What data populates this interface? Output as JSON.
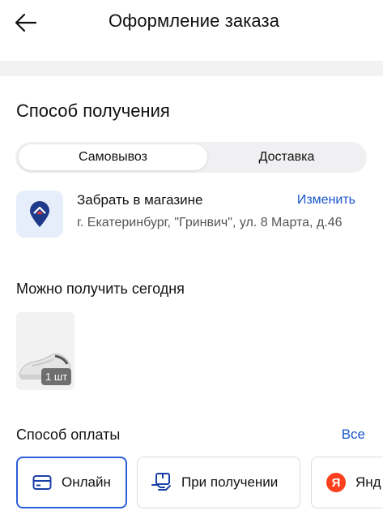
{
  "header": {
    "title": "Оформление заказа",
    "back_icon": "arrow-left-icon"
  },
  "receive": {
    "title": "Способ получения",
    "tabs": [
      {
        "label": "Самовывоз",
        "active": true
      },
      {
        "label": "Доставка",
        "active": false
      }
    ],
    "store": {
      "title": "Забрать в магазине",
      "change_label": "Изменить",
      "address": "г. Екатеринбург, \"Гринвич\", ул. 8 Марта, д.46",
      "icon": "map-pin-icon"
    }
  },
  "available": {
    "title": "Можно получить сегодня",
    "items": [
      {
        "qty": "1 шт",
        "image": "sneaker-image"
      }
    ]
  },
  "payment": {
    "title": "Способ оплаты",
    "all_label": "Все",
    "methods": [
      {
        "label": "Онлайн",
        "icon": "credit-card-icon",
        "selected": true
      },
      {
        "label": "При получении",
        "icon": "package-icon",
        "selected": false
      },
      {
        "label": "Янд",
        "icon": "yandex-logo-icon",
        "selected": false
      }
    ]
  },
  "colors": {
    "accent": "#2b5fd9",
    "link": "#1a56c8",
    "yandex": "#fc3f1d",
    "pin": "#1e3a8a"
  }
}
